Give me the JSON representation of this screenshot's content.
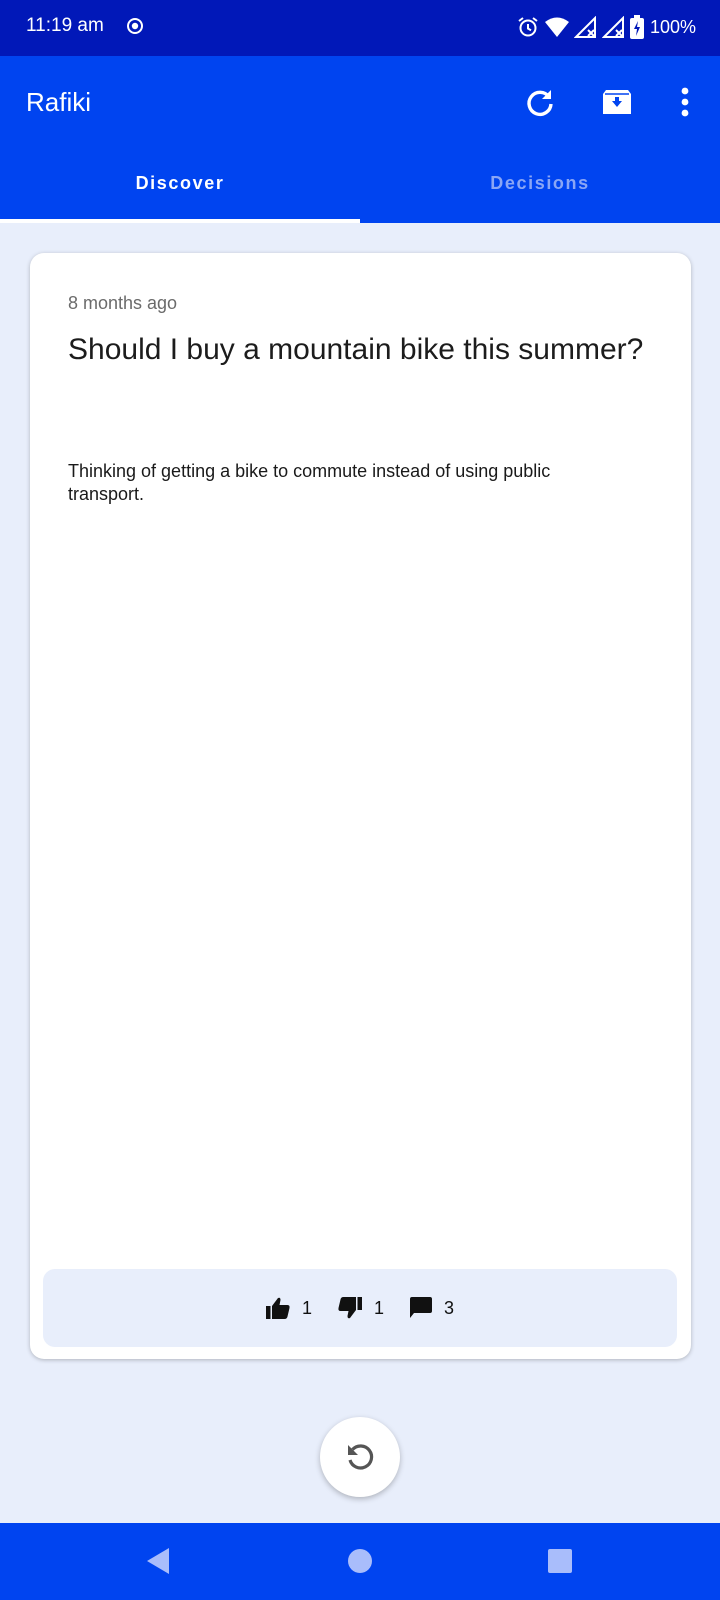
{
  "status_bar": {
    "time": "11:19 am",
    "battery": "100%",
    "icons": [
      "record-icon",
      "alarm-icon",
      "wifi-icon",
      "signal-icon",
      "signal-icon",
      "battery-charging-icon"
    ]
  },
  "app_bar": {
    "title": "Rafiki",
    "actions": [
      "refresh-icon",
      "archive-icon",
      "more-vert-icon"
    ],
    "color": "#0044f0"
  },
  "tabs": [
    {
      "label": "Discover",
      "selected": true
    },
    {
      "label": "Decisions",
      "selected": false
    }
  ],
  "card": {
    "time_ago": "8 months ago",
    "title": "Should I buy a mountain bike this summer?",
    "body": "Thinking of getting a bike to commute instead of using public transport.",
    "stats": {
      "likes": "1",
      "dislikes": "1",
      "comments": "3"
    }
  },
  "fab": {
    "icon": "undo-icon"
  },
  "nav_bar": {
    "icons": [
      "back-icon",
      "home-icon",
      "recents-icon"
    ]
  }
}
